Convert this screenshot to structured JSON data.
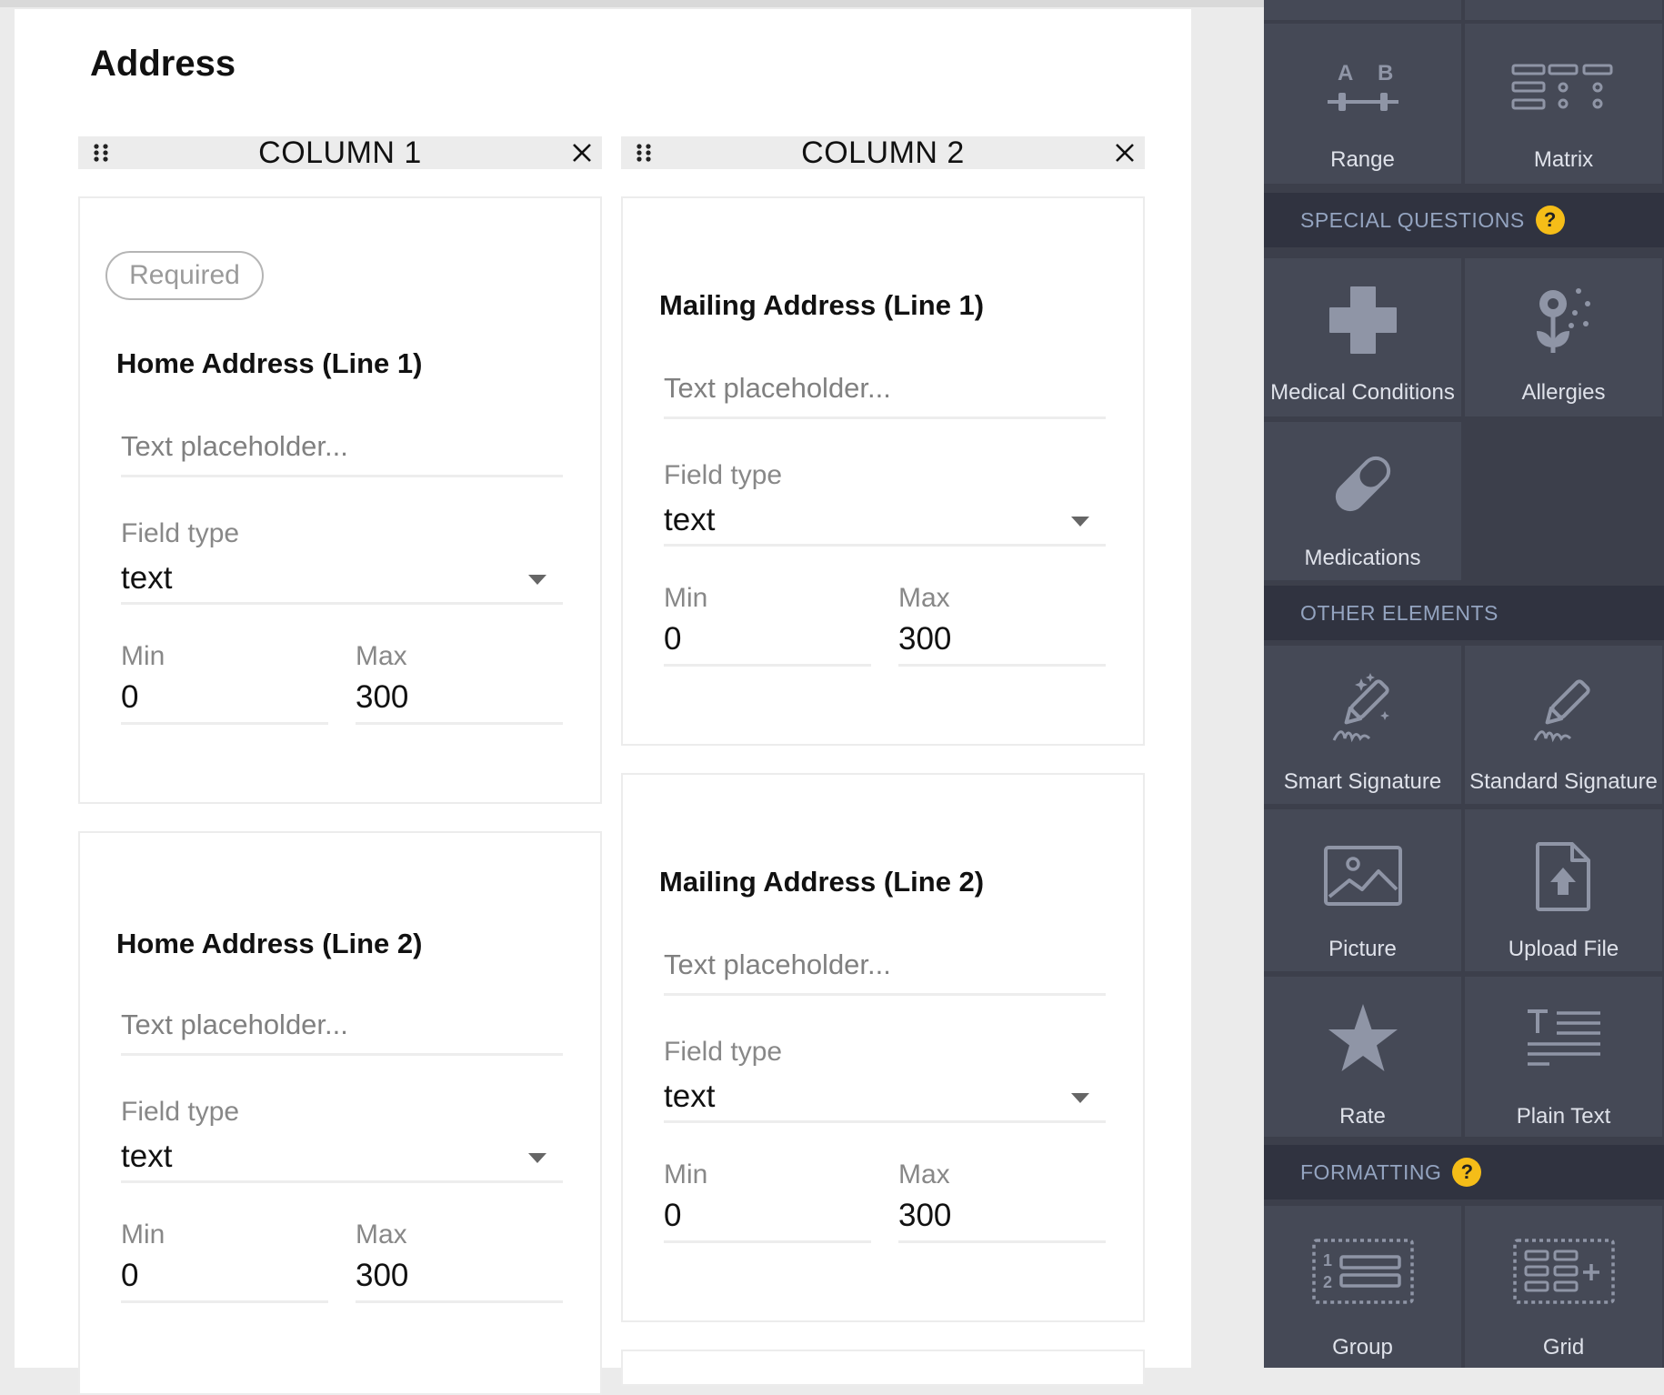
{
  "section": {
    "title": "Address"
  },
  "columns": [
    {
      "header": "COLUMN 1"
    },
    {
      "header": "COLUMN 2"
    }
  ],
  "cards": [
    {
      "required_badge": "Required",
      "label": "Home Address (Line 1)",
      "placeholder": "Text placeholder...",
      "field_type_label": "Field type",
      "field_type_value": "text",
      "min_label": "Min",
      "min_value": "0",
      "max_label": "Max",
      "max_value": "300"
    },
    {
      "label": "Home Address (Line 2)",
      "placeholder": "Text placeholder...",
      "field_type_label": "Field type",
      "field_type_value": "text",
      "min_label": "Min",
      "min_value": "0",
      "max_label": "Max",
      "max_value": "300"
    },
    {
      "label": "Mailing Address (Line 1)",
      "placeholder": "Text placeholder...",
      "field_type_label": "Field type",
      "field_type_value": "text",
      "min_label": "Min",
      "min_value": "0",
      "max_label": "Max",
      "max_value": "300"
    },
    {
      "label": "Mailing Address (Line 2)",
      "placeholder": "Text placeholder...",
      "field_type_label": "Field type",
      "field_type_value": "text",
      "min_label": "Min",
      "min_value": "0",
      "max_label": "Max",
      "max_value": "300"
    }
  ],
  "sidebar": {
    "tiles_top": [
      {
        "label": "Range",
        "icon": "range-icon"
      },
      {
        "label": "Matrix",
        "icon": "matrix-icon"
      }
    ],
    "special": {
      "header": "SPECIAL QUESTIONS",
      "help": "?",
      "tiles": [
        {
          "label": "Medical Conditions",
          "icon": "medical-cross-icon"
        },
        {
          "label": "Allergies",
          "icon": "flower-icon"
        },
        {
          "label": "Medications",
          "icon": "pill-icon"
        }
      ]
    },
    "other": {
      "header": "OTHER ELEMENTS",
      "tiles": [
        {
          "label": "Smart Signature",
          "icon": "smart-signature-icon"
        },
        {
          "label": "Standard Signature",
          "icon": "signature-pen-icon"
        },
        {
          "label": "Picture",
          "icon": "picture-icon"
        },
        {
          "label": "Upload File",
          "icon": "upload-file-icon"
        },
        {
          "label": "Rate",
          "icon": "star-icon"
        },
        {
          "label": "Plain Text",
          "icon": "plain-text-icon"
        }
      ]
    },
    "formatting": {
      "header": "FORMATTING",
      "help": "?",
      "tiles": [
        {
          "label": "Group",
          "icon": "group-icon"
        },
        {
          "label": "Grid",
          "icon": "grid-icon"
        }
      ]
    }
  },
  "colors": {
    "sidebar_bg": "#3c3f4b",
    "tile_bg": "#454956",
    "header_bg": "#303340",
    "help_badge": "#f5bd18"
  }
}
